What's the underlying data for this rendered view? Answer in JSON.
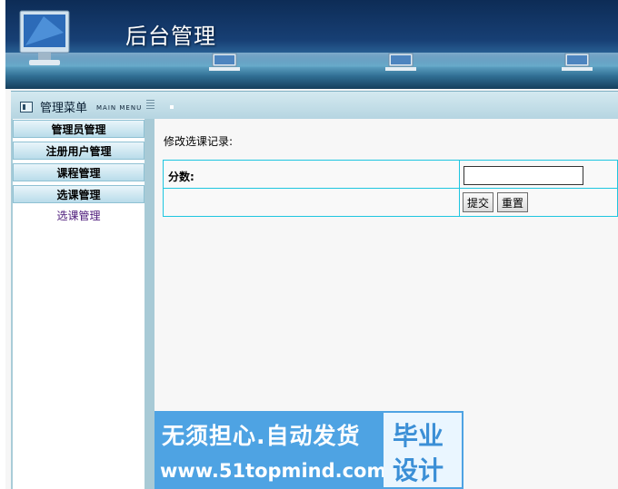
{
  "header": {
    "title": "后台管理"
  },
  "menu": {
    "title": "管理菜单",
    "subtitle": "MAIN MENU",
    "sections": [
      {
        "label": "管理员管理"
      },
      {
        "label": "注册用户管理"
      },
      {
        "label": "课程管理"
      },
      {
        "label": "选课管理"
      }
    ],
    "active_link": "选课管理"
  },
  "form": {
    "heading": "修改选课记录:",
    "score_label": "分数:",
    "score_value": "",
    "submit_label": "提交",
    "reset_label": "重置"
  },
  "watermark": {
    "line1": "无须担心.自动发货",
    "line2": "www.51topmind.com",
    "badge_line1": "毕业",
    "badge_line2": "设计"
  },
  "colors": {
    "banner_dark": "#0d2c56",
    "menu_bar": "#b6d5e1",
    "table_border": "#1ec6e0",
    "watermark_blue": "#4ea3e3"
  }
}
